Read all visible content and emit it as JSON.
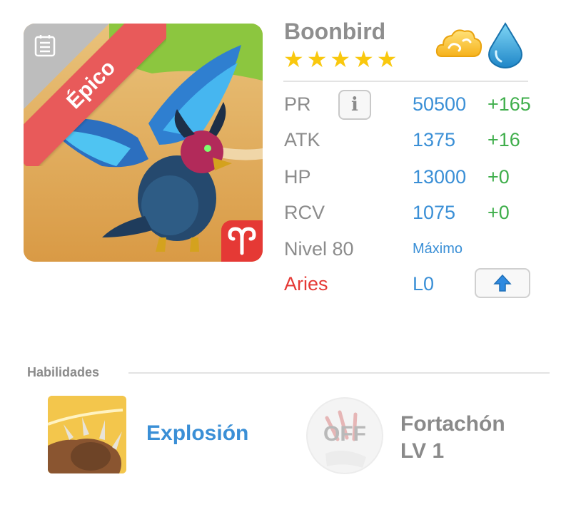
{
  "monster": {
    "name": "Boonbird",
    "rarity_label": "Épico",
    "stars": 5,
    "elements": [
      "cloud-element-icon",
      "water-element-icon"
    ]
  },
  "stats": {
    "pr": {
      "label": "PR",
      "value": "50500",
      "bonus": "+165"
    },
    "atk": {
      "label": "ATK",
      "value": "1375",
      "bonus": "+16"
    },
    "hp": {
      "label": "HP",
      "value": "13000",
      "bonus": "+0"
    },
    "rcv": {
      "label": "RCV",
      "value": "1075",
      "bonus": "+0"
    },
    "level": {
      "label": "Nivel 80",
      "status": "Máximo"
    },
    "sign": {
      "label": "Aries",
      "level": "L0"
    }
  },
  "abilities": {
    "title": "Habilidades",
    "items": [
      {
        "name": "Explosión"
      },
      {
        "name_line1": "Fortachón",
        "name_line2": "LV 1",
        "state": "OFF"
      }
    ]
  },
  "colors": {
    "accent_blue": "#3a8fd6",
    "bonus_green": "#3fae4b",
    "sign_red": "#e53935",
    "star_yellow": "#f9c80e",
    "rarity_red": "#e85a5a"
  }
}
